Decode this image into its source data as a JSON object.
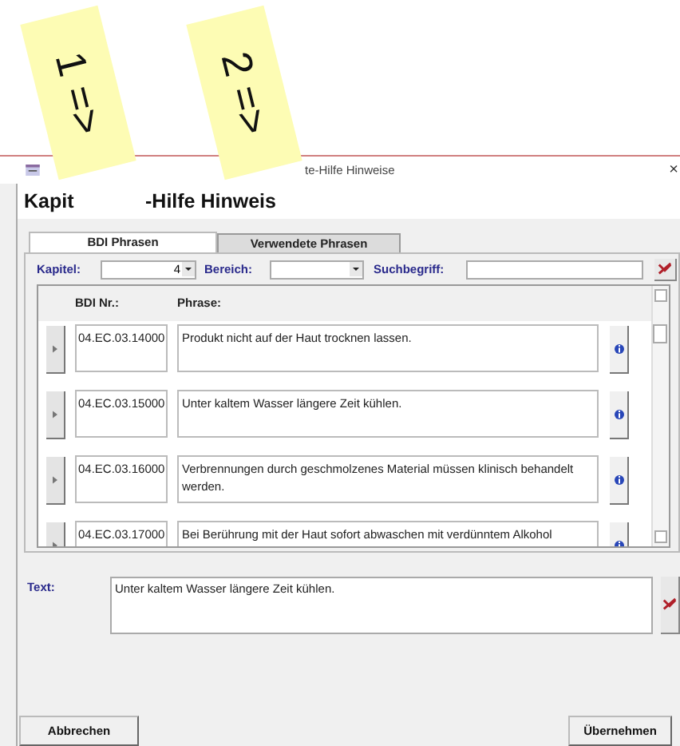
{
  "sticky_notes": [
    {
      "text": "1 =>"
    },
    {
      "text": "2 =>"
    }
  ],
  "window": {
    "title": "te-Hilfe Hinweise",
    "close": "×"
  },
  "heading": [
    "Kapit",
    "-Hilfe Hinweis"
  ],
  "tabs": [
    {
      "label": "BDI Phrasen",
      "selected": true
    },
    {
      "label": "Verwendete Phrasen",
      "selected": false
    }
  ],
  "filters": {
    "kapitel_label": "Kapitel:",
    "kapitel_value": "4",
    "bereich_label": "Bereich:",
    "suchbegriff_label": "Suchbegriff:"
  },
  "list": {
    "columns": [
      "BDI Nr.:",
      "Phrase:"
    ],
    "rows": [
      {
        "nr": "04.EC.03.14000",
        "phrase": "Produkt nicht auf der Haut trocknen lassen."
      },
      {
        "nr": "04.EC.03.15000",
        "phrase": "Unter kaltem Wasser längere Zeit kühlen."
      },
      {
        "nr": "04.EC.03.16000",
        "phrase": "Verbrennungen durch geschmolzenes Material müssen klinisch behandelt werden."
      },
      {
        "nr": "04.EC.03.17000",
        "phrase": "Bei Berührung mit der Haut sofort abwaschen mit verdünntem Alkohol"
      }
    ]
  },
  "text_label": "Text:",
  "text_value": "Unter kaltem Wasser längere Zeit kühlen.",
  "buttons": [
    "Abbrechen",
    "Übernehmen"
  ]
}
